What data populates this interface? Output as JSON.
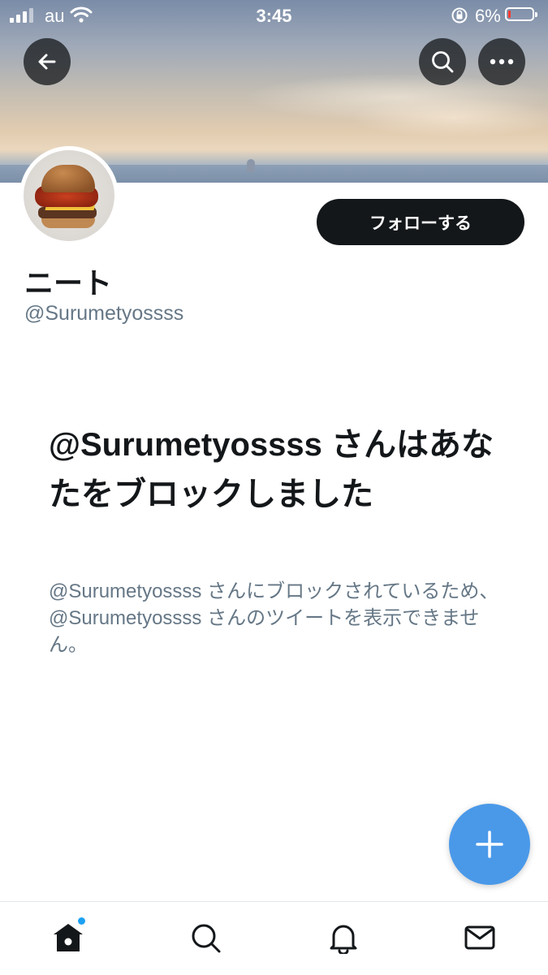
{
  "status_bar": {
    "carrier": "au",
    "time": "3:45",
    "battery_percent": "6%"
  },
  "profile": {
    "display_name": "ニート",
    "handle": "@Surumetyossss",
    "follow_label": "フォローする"
  },
  "blocked": {
    "title": "@Surumetyossss さんはあなたをブロックしました",
    "description": "@Surumetyossss さんにブロックされているため、@Surumetyossss さんのツイートを表示できません。"
  },
  "icons": {
    "back": "back-arrow-icon",
    "search": "search-icon",
    "more": "more-icon",
    "compose": "plus-icon",
    "home": "home-icon",
    "explore": "search-icon",
    "notifications": "bell-icon",
    "messages": "mail-icon"
  },
  "colors": {
    "accent": "#1da1f2",
    "fab": "#4a99e9",
    "text_primary": "#14171a",
    "text_secondary": "#657786"
  }
}
